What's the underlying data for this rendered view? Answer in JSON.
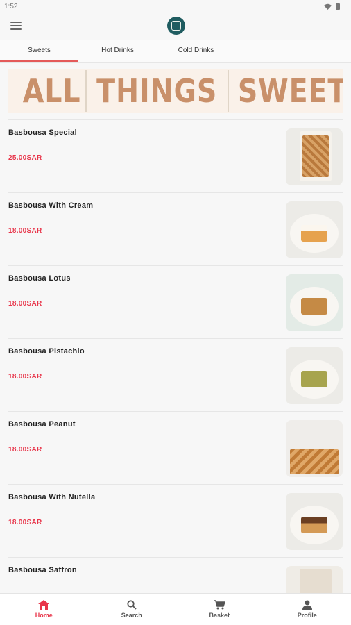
{
  "status_bar": {
    "time": "1:52"
  },
  "header": {
    "logo_name": "cafe-logo"
  },
  "tabs": [
    {
      "label": "Sweets",
      "active": true
    },
    {
      "label": "Hot Drinks",
      "active": false
    },
    {
      "label": "Cold Drinks",
      "active": false
    }
  ],
  "banner": {
    "words": [
      "ALL",
      "THINGS",
      "SWEET"
    ]
  },
  "products": [
    {
      "name": "Basbousa Special",
      "price": "25.00SAR",
      "image": "basbousa-special-photo"
    },
    {
      "name": "Basbousa With Cream",
      "price": "18.00SAR",
      "image": "basbousa-cream-photo"
    },
    {
      "name": "Basbousa Lotus",
      "price": "18.00SAR",
      "image": "basbousa-lotus-photo"
    },
    {
      "name": "Basbousa Pistachio",
      "price": "18.00SAR",
      "image": "basbousa-pistachio-photo"
    },
    {
      "name": "Basbousa Peanut",
      "price": "18.00SAR",
      "image": "basbousa-peanut-photo"
    },
    {
      "name": "Basbousa With Nutella",
      "price": "18.00SAR",
      "image": "basbousa-nutella-photo"
    },
    {
      "name": "Basbousa Saffron",
      "price": "",
      "image": "basbousa-saffron-photo"
    }
  ],
  "bottom_nav": [
    {
      "label": "Home",
      "icon": "home-icon",
      "active": true
    },
    {
      "label": "Search",
      "icon": "search-icon",
      "active": false
    },
    {
      "label": "Basket",
      "icon": "cart-icon",
      "active": false
    },
    {
      "label": "Profile",
      "icon": "person-icon",
      "active": false
    }
  ],
  "colors": {
    "accent": "#e8354a",
    "banner_text": "#c9906a",
    "logo_bg": "#1f5c60"
  }
}
